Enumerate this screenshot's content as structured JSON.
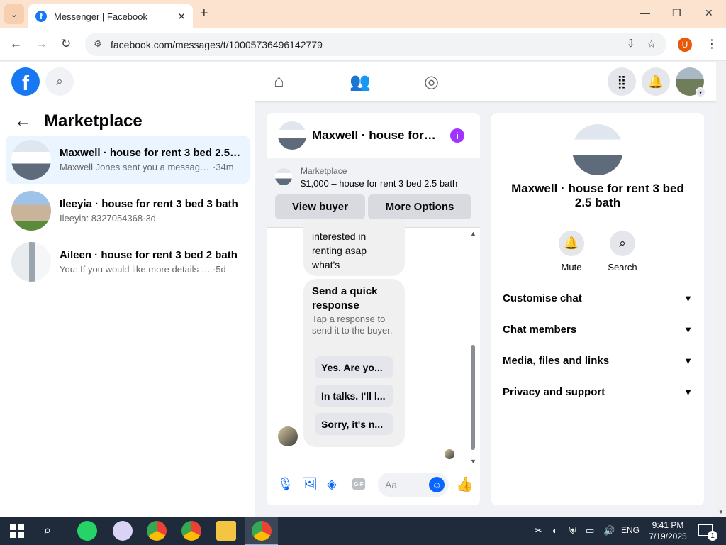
{
  "browser": {
    "tab_title": "Messenger | Facebook",
    "favicon": "f",
    "url": "facebook.com/messages/t/100057364961427​79",
    "profile_initial": "U"
  },
  "fbnav": {
    "logo": "f",
    "icons": [
      "search-icon",
      "home-icon",
      "friends-icon",
      "groups-icon",
      "menu-grid-icon",
      "notifications-icon"
    ]
  },
  "left": {
    "title": "Marketplace",
    "conversations": [
      {
        "name": "Maxwell · house for rent 3 bed 2.5 ...",
        "snippet": "Maxwell Jones sent you a message ...",
        "time": "·34m"
      },
      {
        "name": "Ileeyia · house for rent 3 bed 3 bath",
        "snippet": "Ileeyia: 8327054368",
        "time": "·3d"
      },
      {
        "name": "Aileen · house for rent 3 bed 2 bath",
        "snippet": "You: If you would like more details ab...",
        "time": "·5d"
      }
    ]
  },
  "chat": {
    "header_name": "Maxwell · house for r...",
    "marketplace_label": "Marketplace",
    "listing": "$1,000 – house for rent 3 bed 2.5 bath",
    "view_buyer": "View buyer",
    "more_options": "More Options",
    "message_text": "interested in renting asap what's",
    "quick_title": "Send a quick response",
    "quick_sub": "Tap a response to send it to the buyer.",
    "quick_replies": [
      "Yes. Are yo...",
      "In talks. I'll l...",
      "Sorry, it's n..."
    ],
    "placeholder": "Aa"
  },
  "info": {
    "name": "Maxwell · house for rent 3 bed 2.5 bath",
    "mute": "Mute",
    "search": "Search",
    "sections": [
      "Customise chat",
      "Chat members",
      "Media, files and links",
      "Privacy and support"
    ]
  },
  "taskbar": {
    "lang": "ENG",
    "time": "9:41 PM",
    "date": "7/19/2025",
    "notifications": "1"
  },
  "colors": {
    "fb_blue": "#1877f2",
    "messenger_blue": "#0866ff",
    "purple_info": "#a033ff"
  }
}
